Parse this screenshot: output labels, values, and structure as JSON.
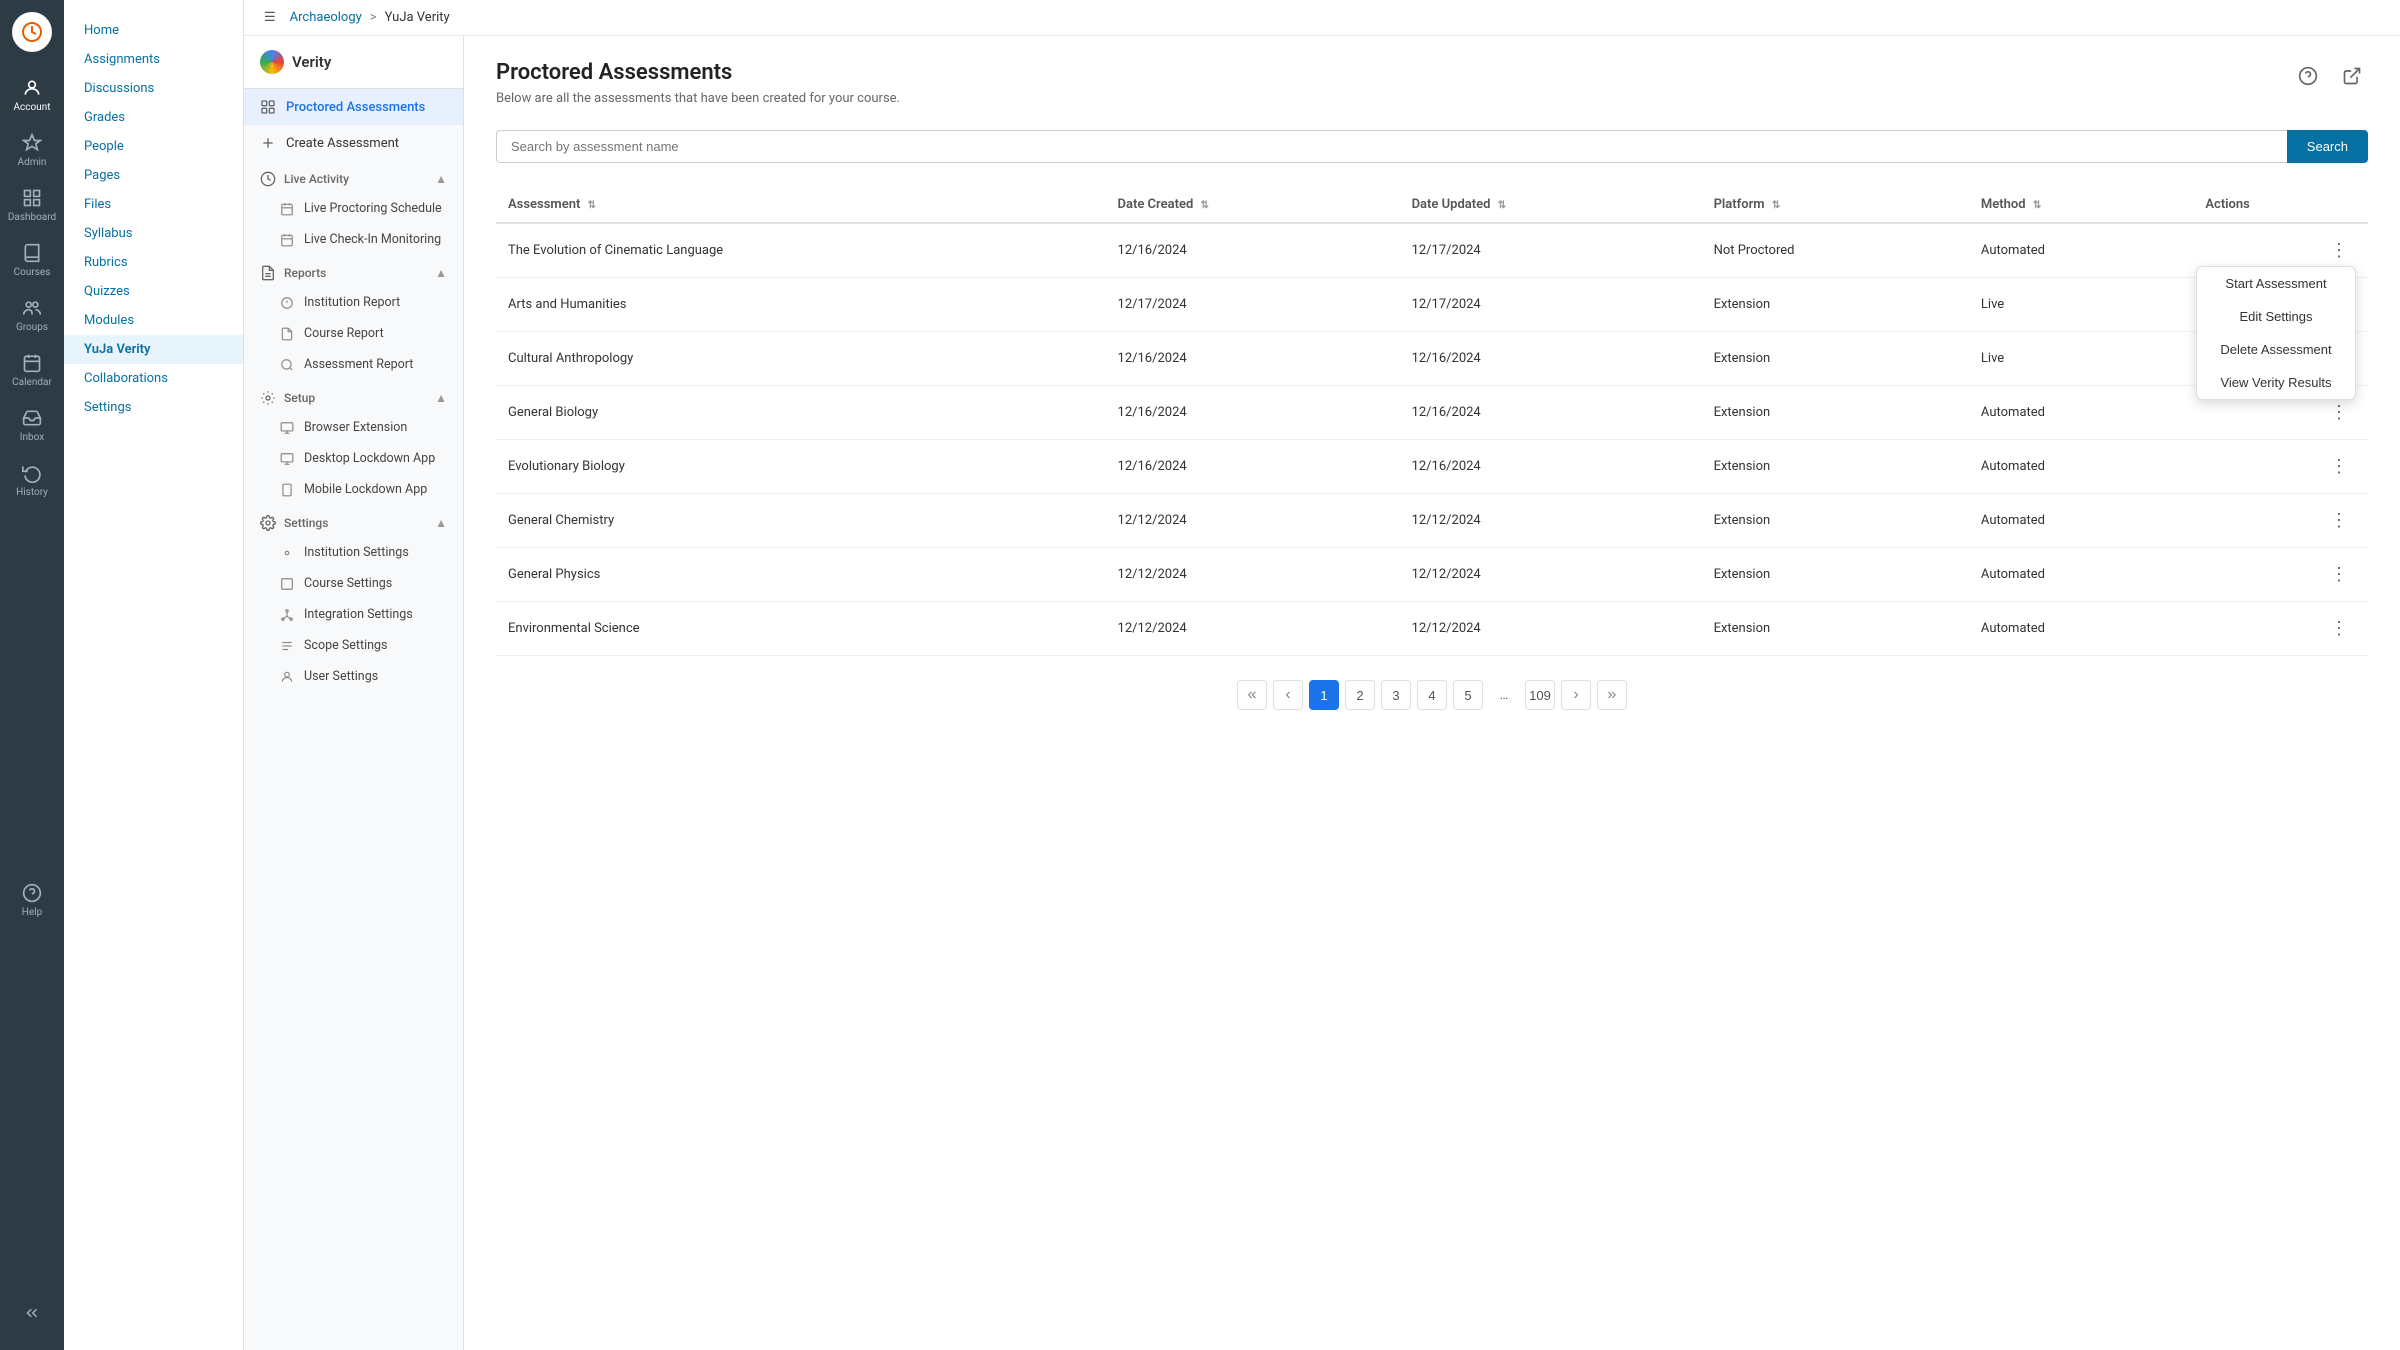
{
  "app": {
    "logo_label": "Canvas",
    "nav_items": [
      {
        "id": "account",
        "label": "Account"
      },
      {
        "id": "admin",
        "label": "Admin"
      },
      {
        "id": "dashboard",
        "label": "Dashboard"
      },
      {
        "id": "courses",
        "label": "Courses"
      },
      {
        "id": "groups",
        "label": "Groups"
      },
      {
        "id": "calendar",
        "label": "Calendar"
      },
      {
        "id": "inbox",
        "label": "Inbox"
      },
      {
        "id": "history",
        "label": "History"
      },
      {
        "id": "help",
        "label": "Help"
      }
    ],
    "collapse_label": "Collapse"
  },
  "breadcrumb": {
    "root": "Archaeology",
    "separator": ">",
    "current": "YuJa Verity"
  },
  "course_sidebar": {
    "links": [
      {
        "id": "home",
        "label": "Home"
      },
      {
        "id": "assignments",
        "label": "Assignments"
      },
      {
        "id": "discussions",
        "label": "Discussions"
      },
      {
        "id": "grades",
        "label": "Grades"
      },
      {
        "id": "people",
        "label": "People"
      },
      {
        "id": "pages",
        "label": "Pages"
      },
      {
        "id": "files",
        "label": "Files"
      },
      {
        "id": "syllabus",
        "label": "Syllabus"
      },
      {
        "id": "rubrics",
        "label": "Rubrics"
      },
      {
        "id": "quizzes",
        "label": "Quizzes"
      },
      {
        "id": "modules",
        "label": "Modules"
      },
      {
        "id": "yuja-verity",
        "label": "YuJa Verity"
      },
      {
        "id": "collaborations",
        "label": "Collaborations"
      },
      {
        "id": "settings",
        "label": "Settings"
      }
    ]
  },
  "verity": {
    "brand": "Verity",
    "sidebar": {
      "proctored_assessments": "Proctored Assessments",
      "create_assessment": "Create Assessment",
      "live_activity": {
        "label": "Live Activity",
        "children": [
          {
            "id": "live-proctoring-schedule",
            "label": "Live Proctoring Schedule"
          },
          {
            "id": "live-checkin-monitoring",
            "label": "Live Check-In Monitoring"
          }
        ]
      },
      "reports": {
        "label": "Reports",
        "children": [
          {
            "id": "institution-report",
            "label": "Institution Report"
          },
          {
            "id": "course-report",
            "label": "Course Report"
          },
          {
            "id": "assessment-report",
            "label": "Assessment Report"
          }
        ]
      },
      "setup": {
        "label": "Setup",
        "children": [
          {
            "id": "browser-extension",
            "label": "Browser Extension"
          },
          {
            "id": "desktop-lockdown-app",
            "label": "Desktop Lockdown App"
          },
          {
            "id": "mobile-lockdown-app",
            "label": "Mobile Lockdown App"
          }
        ]
      },
      "settings": {
        "label": "Settings",
        "children": [
          {
            "id": "institution-settings",
            "label": "Institution Settings"
          },
          {
            "id": "course-settings",
            "label": "Course Settings"
          },
          {
            "id": "integration-settings",
            "label": "Integration Settings"
          },
          {
            "id": "scope-settings",
            "label": "Scope Settings"
          },
          {
            "id": "user-settings",
            "label": "User Settings"
          }
        ]
      }
    },
    "content": {
      "title": "Proctored Assessments",
      "subtitle": "Below are all the assessments that have been created for your course.",
      "search_placeholder": "Search by assessment name",
      "search_button": "Search",
      "topbar_icons": {
        "help": "?",
        "export": "↗"
      },
      "table": {
        "headers": [
          {
            "id": "assessment",
            "label": "Assessment"
          },
          {
            "id": "date-created",
            "label": "Date Created"
          },
          {
            "id": "date-updated",
            "label": "Date Updated"
          },
          {
            "id": "platform",
            "label": "Platform"
          },
          {
            "id": "method",
            "label": "Method"
          },
          {
            "id": "actions",
            "label": "Actions"
          }
        ],
        "rows": [
          {
            "assessment": "The Evolution of Cinematic Language",
            "date_created": "12/16/2024",
            "date_updated": "12/17/2024",
            "platform": "Not Proctored",
            "method": "Automated",
            "show_dropdown": true
          },
          {
            "assessment": "Arts and Humanities",
            "date_created": "12/17/2024",
            "date_updated": "12/17/2024",
            "platform": "Extension",
            "method": "Live",
            "show_dropdown": false
          },
          {
            "assessment": "Cultural Anthropology",
            "date_created": "12/16/2024",
            "date_updated": "12/16/2024",
            "platform": "Extension",
            "method": "Live",
            "show_dropdown": false
          },
          {
            "assessment": "General Biology",
            "date_created": "12/16/2024",
            "date_updated": "12/16/2024",
            "platform": "Extension",
            "method": "Automated",
            "show_dropdown": false
          },
          {
            "assessment": "Evolutionary Biology",
            "date_created": "12/16/2024",
            "date_updated": "12/16/2024",
            "platform": "Extension",
            "method": "Automated",
            "show_dropdown": false
          },
          {
            "assessment": "General Chemistry",
            "date_created": "12/12/2024",
            "date_updated": "12/12/2024",
            "platform": "Extension",
            "method": "Automated",
            "show_dropdown": false
          },
          {
            "assessment": "General Physics",
            "date_created": "12/12/2024",
            "date_updated": "12/12/2024",
            "platform": "Extension",
            "method": "Automated",
            "show_dropdown": false
          },
          {
            "assessment": "Environmental Science",
            "date_created": "12/12/2024",
            "date_updated": "12/12/2024",
            "platform": "Extension",
            "method": "Automated",
            "show_dropdown": false
          }
        ],
        "dropdown_items": [
          "Start Assessment",
          "Edit Settings",
          "Delete Assessment",
          "View Verity Results"
        ]
      },
      "pagination": {
        "first": "«",
        "prev": "‹",
        "pages": [
          "1",
          "2",
          "3",
          "4",
          "5"
        ],
        "ellipsis": "…",
        "last_page": "109",
        "next": "›",
        "last": "»",
        "active_page": "1"
      }
    }
  },
  "colors": {
    "accent": "#0770a2",
    "active_page": "#1a73e8",
    "nav_bg": "#2d3b45"
  }
}
